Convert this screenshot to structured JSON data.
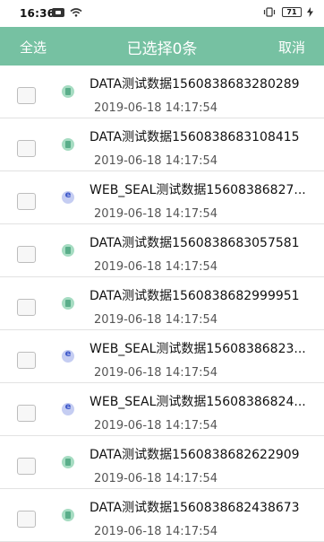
{
  "status_bar": {
    "time": "16:36",
    "battery": "71"
  },
  "header": {
    "select_all": "全选",
    "title": "已选择0条",
    "cancel": "取消",
    "background_color": "#76c1a2"
  },
  "items": [
    {
      "type": "data",
      "title": "DATA测试数据1560838683280289",
      "time": "2019-06-18 14:17:54"
    },
    {
      "type": "data",
      "title": "DATA测试数据1560838683108415",
      "time": "2019-06-18 14:17:54"
    },
    {
      "type": "web",
      "title": "WEB_SEAL测试数据15608386827...",
      "time": "2019-06-18 14:17:54"
    },
    {
      "type": "data",
      "title": "DATA测试数据1560838683057581",
      "time": "2019-06-18 14:17:54"
    },
    {
      "type": "data",
      "title": "DATA测试数据1560838682999951",
      "time": "2019-06-18 14:17:54"
    },
    {
      "type": "web",
      "title": "WEB_SEAL测试数据15608386823...",
      "time": "2019-06-18 14:17:54"
    },
    {
      "type": "web",
      "title": "WEB_SEAL测试数据15608386824...",
      "time": "2019-06-18 14:17:54"
    },
    {
      "type": "data",
      "title": "DATA测试数据1560838682622909",
      "time": "2019-06-18 14:17:54"
    },
    {
      "type": "data",
      "title": "DATA测试数据1560838682438673",
      "time": "2019-06-18 14:17:54"
    }
  ]
}
